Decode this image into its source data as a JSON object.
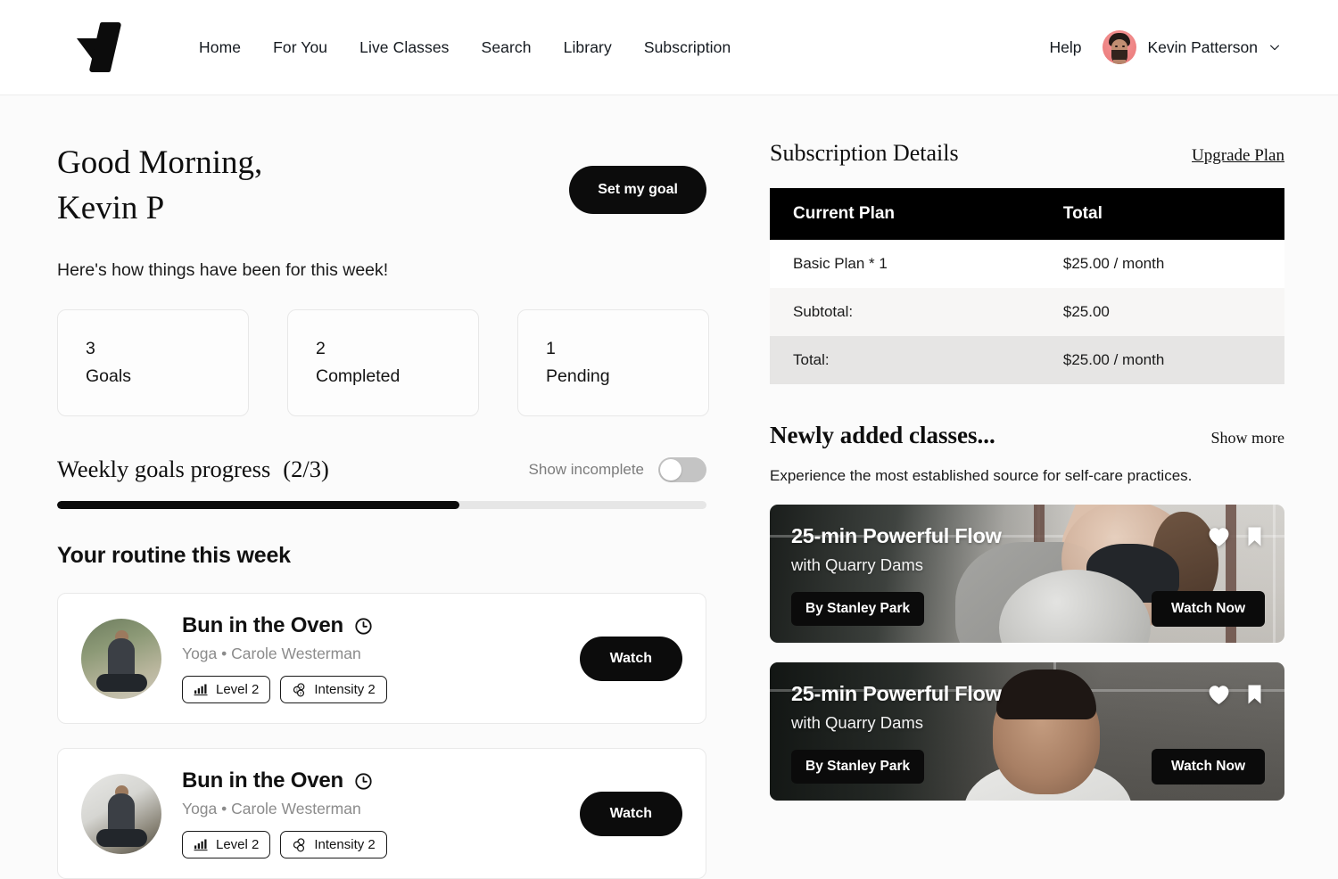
{
  "header": {
    "logo_name": "brand-logo",
    "nav": [
      {
        "label": "Home"
      },
      {
        "label": "For You"
      },
      {
        "label": "Live Classes"
      },
      {
        "label": "Search"
      },
      {
        "label": "Library"
      },
      {
        "label": "Subscription"
      }
    ],
    "help_label": "Help",
    "user_name": "Kevin Patterson",
    "avatar_bg": "#ef8585"
  },
  "left": {
    "greeting_line1": "Good Morning,",
    "greeting_line2": "Kevin P",
    "set_goal_label": "Set my goal",
    "subgreeting": "Here's how things have been for this week!",
    "stats": [
      {
        "value": "3",
        "label": "Goals"
      },
      {
        "value": "2",
        "label": "Completed"
      },
      {
        "value": "1",
        "label": "Pending"
      }
    ],
    "weekly": {
      "title": "Weekly goals progress",
      "count": "(2/3)",
      "toggle_label": "Show incomplete",
      "toggle_on": false,
      "progress_percent": "62%"
    },
    "routine_title": "Your routine this week",
    "routines": [
      {
        "title": "Bun in the Oven",
        "subtitle": "Yoga • Carole Westerman",
        "level_chip": "Level 2",
        "intensity_chip": "Intensity 2",
        "watch_label": "Watch"
      },
      {
        "title": "Bun in the Oven",
        "subtitle": "Yoga • Carole Westerman",
        "level_chip": "Level 2",
        "intensity_chip": "Intensity 2",
        "watch_label": "Watch"
      }
    ]
  },
  "right": {
    "subscription": {
      "title": "Subscription Details",
      "upgrade_label": "Upgrade Plan",
      "columns": [
        "Current Plan",
        "Total"
      ],
      "rows": [
        {
          "key": "Basic Plan * 1",
          "value": "$25.00 / month"
        },
        {
          "key": "Subtotal:",
          "value": "$25.00"
        },
        {
          "key": "Total:",
          "value": "$25.00 / month"
        }
      ]
    },
    "newly_added": {
      "title": "Newly added classes...",
      "show_more_label": "Show more",
      "subtitle": "Experience the most established source for self-care practices.",
      "cards": [
        {
          "title": "25-min Powerful Flow",
          "with": "with Quarry Dams",
          "badge": "By Stanley Park",
          "watch_label": "Watch Now"
        },
        {
          "title": "25-min Powerful Flow",
          "with": "with Quarry Dams",
          "badge": "By Stanley Park",
          "watch_label": "Watch Now"
        }
      ]
    }
  },
  "colors": {
    "accent": "#0c0c0c",
    "page_bg": "#fbfbfb",
    "header_bg": "#ffffff",
    "muted_text": "#8b8b8b",
    "toggle_track": "#c4c4c4"
  }
}
